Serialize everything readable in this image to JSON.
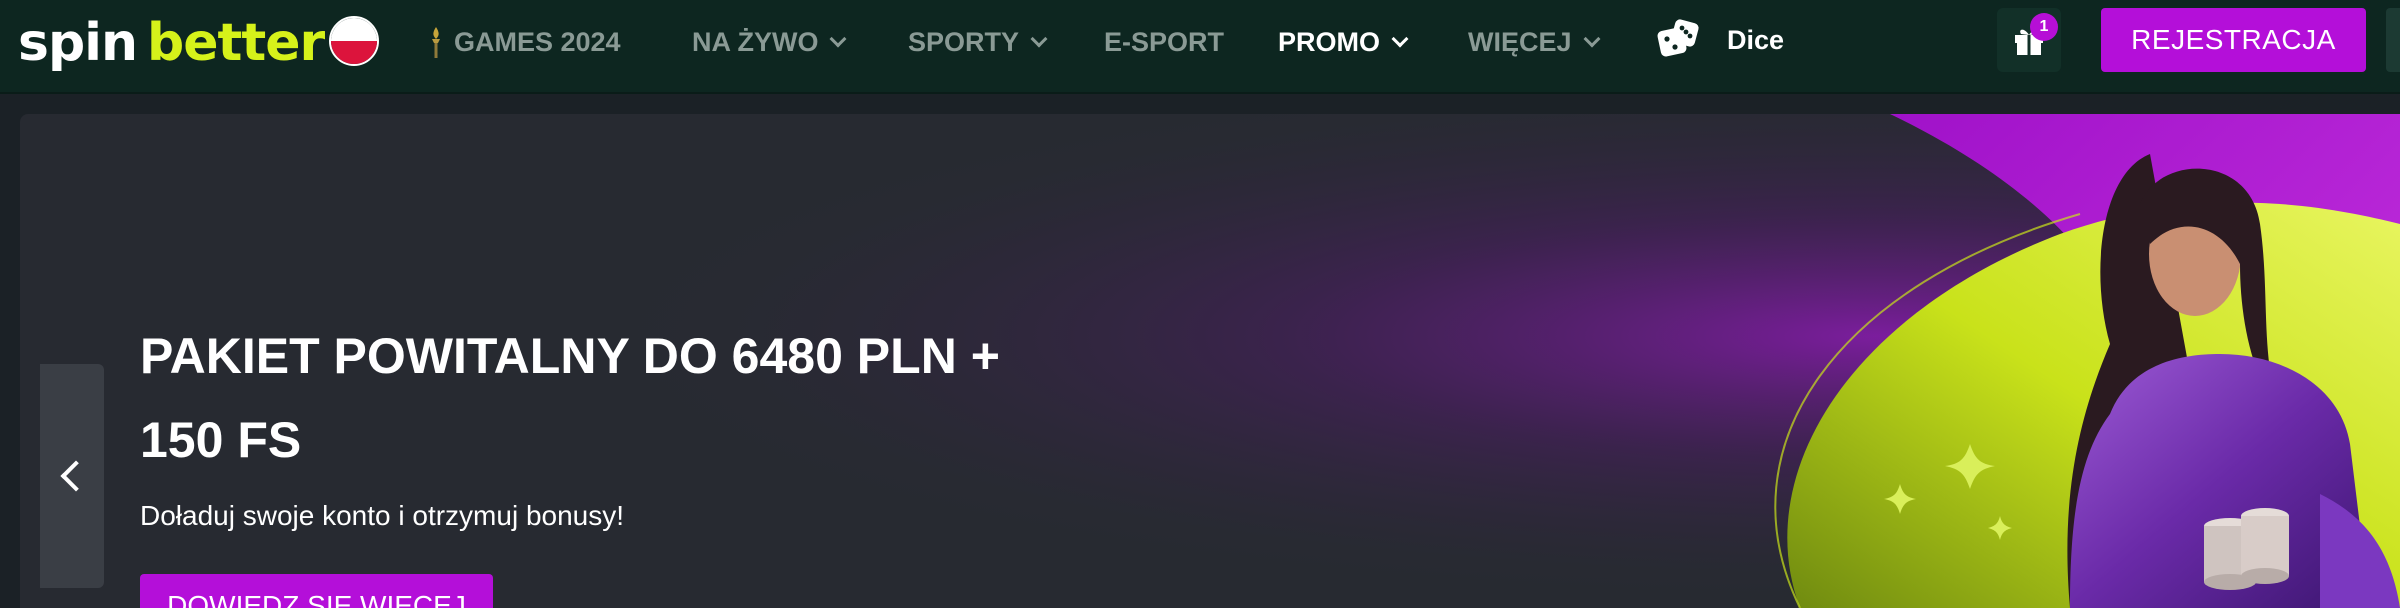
{
  "brand": {
    "logo_part1": "spin",
    "logo_part2": "better",
    "language_flag": "poland-flag-icon"
  },
  "nav": {
    "items": [
      {
        "label": "GAMES 2024",
        "icon": "torch-icon",
        "dropdown": false
      },
      {
        "label": "NA ŻYWO",
        "dropdown": true
      },
      {
        "label": "SPORTY",
        "dropdown": true
      },
      {
        "label": "E-SPORT",
        "dropdown": false
      },
      {
        "label": "PROMO",
        "dropdown": true,
        "active": true
      },
      {
        "label": "WIĘCEJ",
        "dropdown": true
      },
      {
        "label": "Dice",
        "icon": "dice-icon",
        "dropdown": false
      }
    ]
  },
  "header_actions": {
    "gift_icon": "gift-icon",
    "gift_badge": "1",
    "register_label": "REJESTRACJA"
  },
  "banner": {
    "title_line1": "PAKIET POWITALNY DO 6480 PLN +",
    "title_line2": "150 FS",
    "subtitle": "Doładuj swoje konto i otrzymuj bonusy!",
    "cta_label": "DOWIEDZ SIĘ WIĘCEJ"
  },
  "colors": {
    "header_bg": "#0d2620",
    "accent_purple": "#b40fd9",
    "logo_green": "#d6f21a",
    "nav_text": "#8a9a95",
    "banner_bg": "#272a31"
  }
}
